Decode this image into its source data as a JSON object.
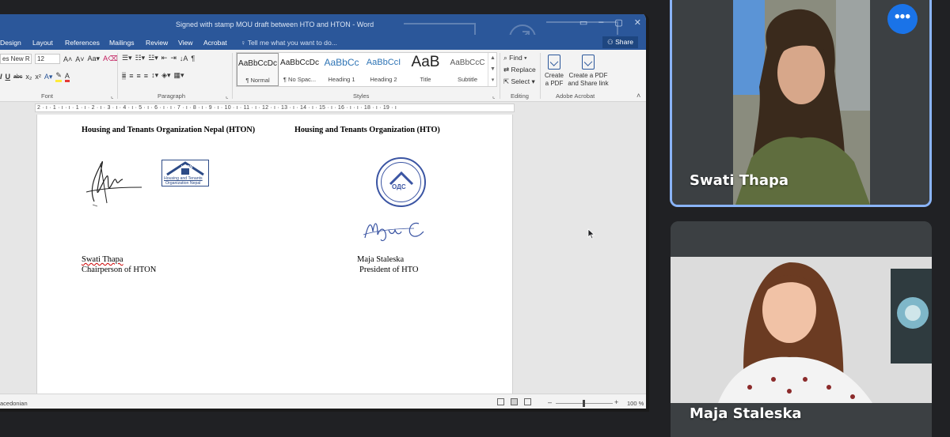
{
  "word": {
    "window_title": "Signed with stamp MOU draft between HTO and HTON - Word",
    "tabs": [
      "Design",
      "Layout",
      "References",
      "Mailings",
      "Review",
      "View",
      "Acrobat"
    ],
    "tell_me": "Tell me what you want to do...",
    "share_label": "Share",
    "font": {
      "family": "es New R",
      "size": "12",
      "group_label": "Font"
    },
    "paragraph_group_label": "Paragraph",
    "styles": {
      "group_label": "Styles",
      "items": [
        {
          "sample": "AaBbCcDc",
          "name": "¶ Normal"
        },
        {
          "sample": "AaBbCcDc",
          "name": "¶ No Spac..."
        },
        {
          "sample": "AaBbCc",
          "name": "Heading 1"
        },
        {
          "sample": "AaBbCcI",
          "name": "Heading 2"
        },
        {
          "sample": "AaB",
          "name": "Title"
        },
        {
          "sample": "AaBbCcC",
          "name": "Subtitle"
        }
      ]
    },
    "editing": {
      "group_label": "Editing",
      "find": "Find",
      "replace": "Replace",
      "select": "Select"
    },
    "acrobat": {
      "group_label": "Adobe Acrobat",
      "create_pdf_1": "Create",
      "create_pdf_2": "a PDF",
      "create_share_1": "Create a PDF",
      "create_share_2": "and Share link"
    },
    "ruler_numbers": "2 · ı · 1 · ı · ı · 1 · ı · 2 · ı · 3 · ı · 4 · ı · 5 · ı · 6 · ı · ı · 7 · ı · 8 · ı · 9 · ı · 10 · ı · 11 · ı · 12 · ı · 13 · ı · 14 · ı · 15 · ı · 16 · ı · ı · 18 · ı · 19 · ı",
    "document": {
      "left_org": "Housing and Tenants Organization Nepal (HTON)",
      "right_org": "Housing and Tenants Organization (HTO)",
      "logo_text_1": "HTON",
      "logo_text_2": "Housing and Tenants",
      "logo_text_3": "Organization Nepal",
      "seal_text": "ОДС",
      "left_signer_name": "Swati Thapa",
      "left_signer_title": "Chairperson of HTON",
      "right_signer_name": "Maja Staleska",
      "right_signer_title": "President of HTO"
    },
    "status": {
      "language": "acedonian",
      "zoom_percent": "100 %"
    }
  },
  "participants": [
    {
      "name": "Swati Thapa",
      "active_speaker": true
    },
    {
      "name": "Maja Staleska",
      "active_speaker": false
    }
  ],
  "colors": {
    "word_blue": "#2b579a",
    "meet_background": "#202124",
    "active_border": "#8ab4f8",
    "more_button": "#1a73e8"
  }
}
